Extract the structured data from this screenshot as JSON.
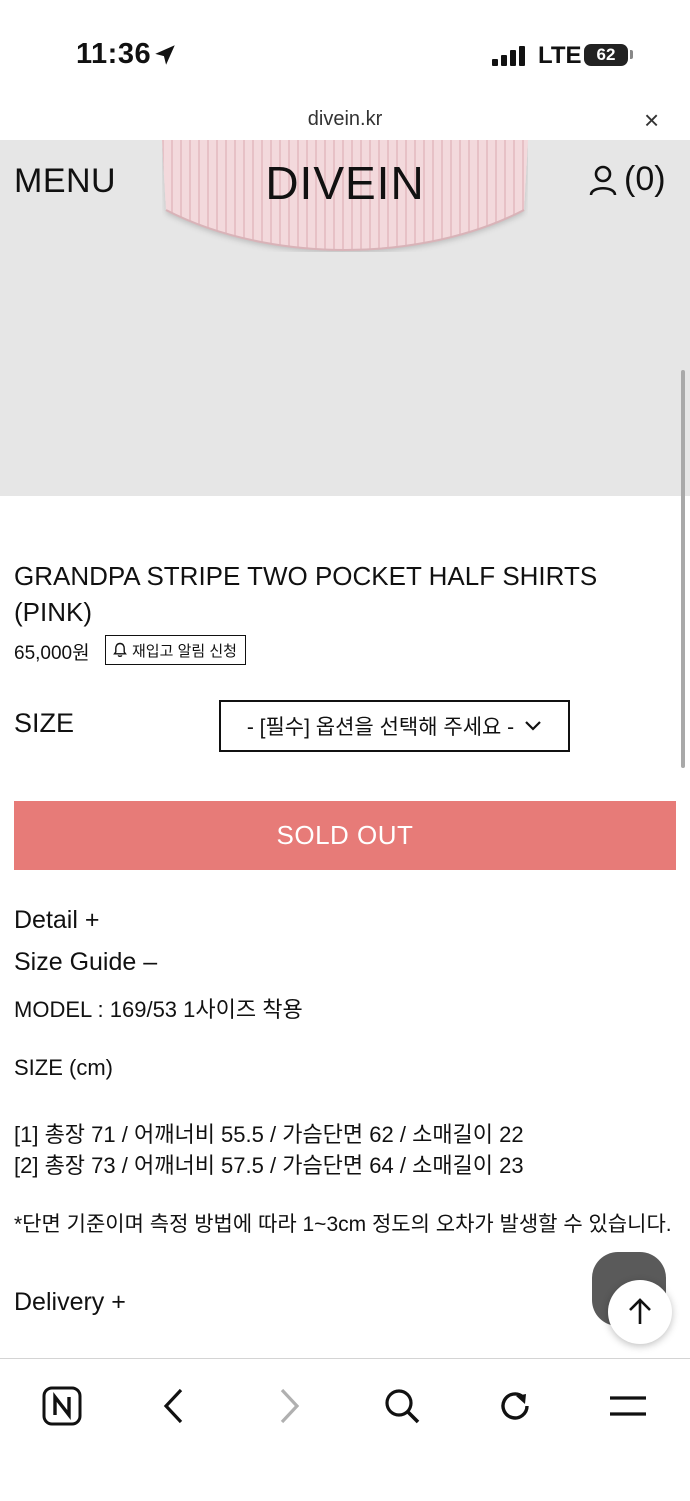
{
  "status_bar": {
    "time": "11:36",
    "network": "LTE",
    "battery": "62"
  },
  "browser": {
    "url": "divein.kr",
    "close": "×"
  },
  "header": {
    "menu": "MENU",
    "logo": "DIVEIN",
    "cart": "(0)"
  },
  "product": {
    "title": "GRANDPA STRIPE TWO POCKET HALF SHIRTS (PINK)",
    "price": "65,000원",
    "restock_label": "재입고 알림 신청"
  },
  "size": {
    "label": "SIZE",
    "select_value": "- [필수] 옵션을 선택해 주세요 -"
  },
  "buy": {
    "label": "SOLD OUT"
  },
  "info": {
    "detail": "Detail +",
    "size_guide": "Size Guide –",
    "model": "MODEL : 169/53 1사이즈 착용",
    "size_cm": "SIZE (cm)",
    "rows": [
      "[1] 총장 71 / 어깨너비 55.5 / 가슴단면 62 / 소매길이 22",
      "[2] 총장 73 / 어깨너비 57.5 / 가슴단면 64 / 소매길이 23"
    ],
    "note": "*단면 기준이며 측정 방법에 따라 1~3cm 정도의 오차가 발생할 수 있습니다.",
    "delivery": "Delivery +"
  },
  "colors": {
    "soldout_bg": "#e77b78",
    "hero_bg": "#e6e6e6"
  },
  "icons": [
    "location-arrow-icon",
    "signal-icon",
    "user-icon",
    "bell-icon",
    "chevron-down-icon",
    "arrow-up-icon",
    "naver-icon",
    "back-icon",
    "forward-icon",
    "search-icon",
    "refresh-icon",
    "menu-icon"
  ]
}
